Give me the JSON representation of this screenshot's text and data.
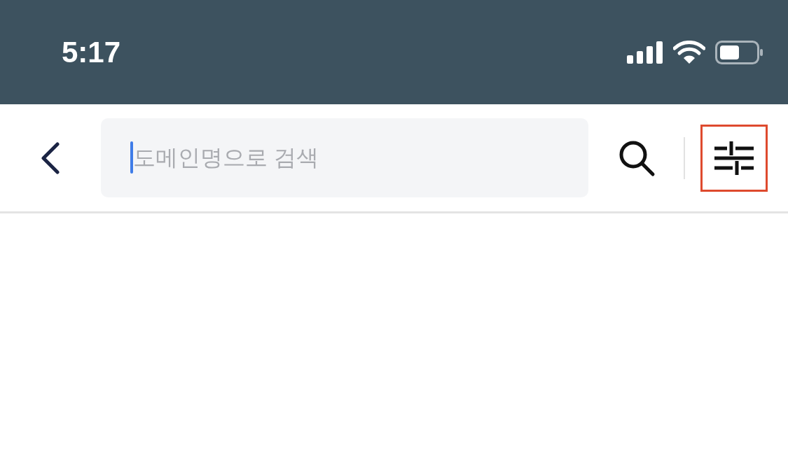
{
  "status_bar": {
    "time": "5:17"
  },
  "search": {
    "placeholder": "도메인명으로 검색",
    "focused": true
  },
  "filter_button": {
    "highlighted": true
  }
}
